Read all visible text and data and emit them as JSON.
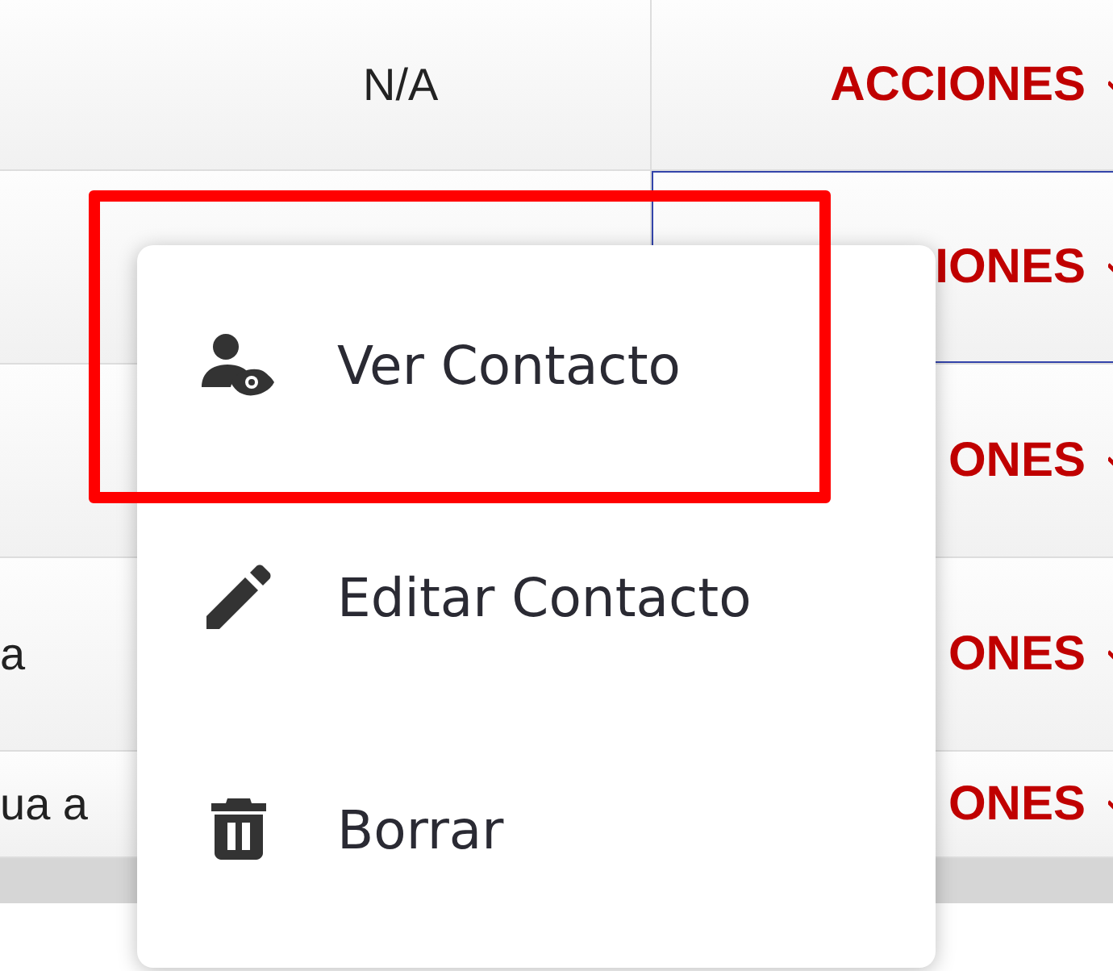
{
  "table": {
    "rows": [
      {
        "text": "N/A",
        "kind": "centered",
        "action": "ACCIONES",
        "focused": false
      },
      {
        "action": "IONES",
        "focused": true
      },
      {
        "action": "ONES",
        "focused": false
      },
      {
        "text": "a",
        "kind": "clipped",
        "action": "ONES",
        "focused": false
      },
      {
        "text": "ua a",
        "kind": "clipped",
        "action": "ONES",
        "focused": false
      }
    ]
  },
  "menu": {
    "items": [
      {
        "kind": "view",
        "label": "Ver Contacto",
        "highlighted": true
      },
      {
        "kind": "edit",
        "label": "Editar Contacto",
        "highlighted": false
      },
      {
        "kind": "delete",
        "label": "Borrar",
        "highlighted": false
      }
    ]
  }
}
